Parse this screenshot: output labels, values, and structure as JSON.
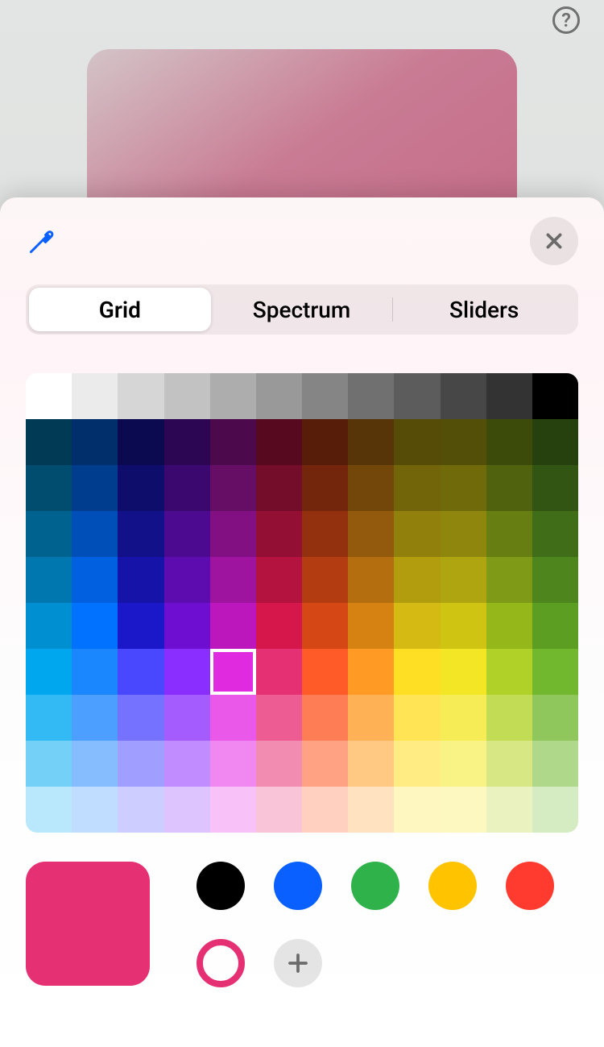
{
  "help_icon": "help-circle-icon",
  "preview_gradient": [
    "#d3c4c8",
    "#c36583"
  ],
  "sheet": {
    "eyedropper_icon": "eyedropper-icon",
    "close_icon": "close-icon",
    "tabs": [
      {
        "label": "Grid",
        "selected": true
      },
      {
        "label": "Spectrum",
        "selected": false
      },
      {
        "label": "Sliders",
        "selected": false
      }
    ],
    "grid": {
      "selected_row": 6,
      "selected_col": 4,
      "rows": [
        [
          "#ffffff",
          "#ebebeb",
          "#d6d6d6",
          "#c2c2c2",
          "#adadad",
          "#999999",
          "#858585",
          "#707070",
          "#5c5c5c",
          "#474747",
          "#333333",
          "#000000"
        ],
        [
          "#003a54",
          "#002f6b",
          "#0b0a50",
          "#2d0653",
          "#4c0a4c",
          "#570a1f",
          "#571d09",
          "#573508",
          "#564b07",
          "#544f08",
          "#3c4a0a",
          "#26400e"
        ],
        [
          "#004d70",
          "#003d8f",
          "#0e0d6b",
          "#3b0870",
          "#660d66",
          "#730d29",
          "#73260b",
          "#73460a",
          "#726409",
          "#706a0a",
          "#50620e",
          "#325513"
        ],
        [
          "#00628e",
          "#004eb7",
          "#121189",
          "#4c0a90",
          "#821082",
          "#931034",
          "#93310e",
          "#935a0d",
          "#92800c",
          "#8f870d",
          "#677e12",
          "#406d18"
        ],
        [
          "#0078af",
          "#0060e0",
          "#1614a8",
          "#5d0cb0",
          "#9f149f",
          "#b41340",
          "#b43c11",
          "#b46e10",
          "#b29d0f",
          "#afa510",
          "#7e9a16",
          "#4e851d"
        ],
        [
          "#008fd0",
          "#0072ff",
          "#1a18c8",
          "#6e0ed1",
          "#bc17bc",
          "#d5174c",
          "#d54714",
          "#d58213",
          "#d4ba12",
          "#d0c413",
          "#96b71a",
          "#5c9e22"
        ],
        [
          "#00a7ee",
          "#1a86ff",
          "#4a48ff",
          "#8a2eff",
          "#e02ae0",
          "#e63074",
          "#ff5b28",
          "#ff9b25",
          "#ffdf24",
          "#f3e625",
          "#b0d128",
          "#72b82f"
        ],
        [
          "#33baf4",
          "#4c9fff",
          "#7472ff",
          "#a55cff",
          "#ea58ea",
          "#ed5c92",
          "#ff7d55",
          "#ffb255",
          "#ffe555",
          "#f6ec55",
          "#c2dc55",
          "#8fc75c"
        ],
        [
          "#75d0f8",
          "#85bdff",
          "#a09eff",
          "#c08cff",
          "#f188f1",
          "#f38cb1",
          "#ffa284",
          "#ffc984",
          "#ffed84",
          "#f9f284",
          "#d6e784",
          "#afd88a"
        ],
        [
          "#b9e7fb",
          "#c0dcff",
          "#cecdff",
          "#dec4ff",
          "#f8c2f8",
          "#f9c4d7",
          "#ffcfc0",
          "#ffe3c0",
          "#fff6c0",
          "#fcf8c0",
          "#eaf3c0",
          "#d5ebc2"
        ]
      ]
    },
    "current_color": "#e63074",
    "presets": [
      {
        "type": "solid",
        "color": "#000000"
      },
      {
        "type": "solid",
        "color": "#0a60ff"
      },
      {
        "type": "solid",
        "color": "#30b24a"
      },
      {
        "type": "solid",
        "color": "#ffc300"
      },
      {
        "type": "solid",
        "color": "#ff3b30"
      },
      {
        "type": "ring",
        "color": "#e63074"
      },
      {
        "type": "add"
      }
    ]
  }
}
